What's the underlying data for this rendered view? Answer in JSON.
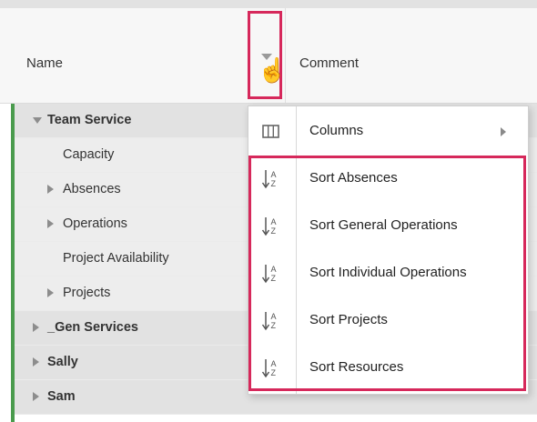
{
  "header": {
    "name_label": "Name",
    "comment_label": "Comment"
  },
  "rows": [
    {
      "label": "Team Service",
      "bold": true,
      "toggle": "expanded"
    },
    {
      "label": "Capacity",
      "bold": false,
      "toggle": "none"
    },
    {
      "label": "Absences",
      "bold": false,
      "toggle": "collapsed"
    },
    {
      "label": "Operations",
      "bold": false,
      "toggle": "collapsed"
    },
    {
      "label": "Project Availability",
      "bold": false,
      "toggle": "none"
    },
    {
      "label": "Projects",
      "bold": false,
      "toggle": "collapsed"
    },
    {
      "label": "_Gen Services",
      "bold": true,
      "toggle": "collapsed"
    },
    {
      "label": "Sally",
      "bold": true,
      "toggle": "collapsed"
    },
    {
      "label": "Sam",
      "bold": true,
      "toggle": "collapsed"
    }
  ],
  "menu": {
    "items": [
      {
        "label": "Columns",
        "icon": "columns-icon",
        "has_submenu": true
      },
      {
        "label": "Sort Absences",
        "icon": "sort-az-icon",
        "has_submenu": false
      },
      {
        "label": "Sort General Operations",
        "icon": "sort-az-icon",
        "has_submenu": false
      },
      {
        "label": "Sort Individual Operations",
        "icon": "sort-az-icon",
        "has_submenu": false
      },
      {
        "label": "Sort Projects",
        "icon": "sort-az-icon",
        "has_submenu": false
      },
      {
        "label": "Sort Resources",
        "icon": "sort-az-icon",
        "has_submenu": false
      }
    ]
  },
  "colors": {
    "highlight": "#d6285b",
    "group_bar": "#4a9b4d",
    "bold_row_bg": "#e2e2e2",
    "row_bg": "#ededed"
  }
}
